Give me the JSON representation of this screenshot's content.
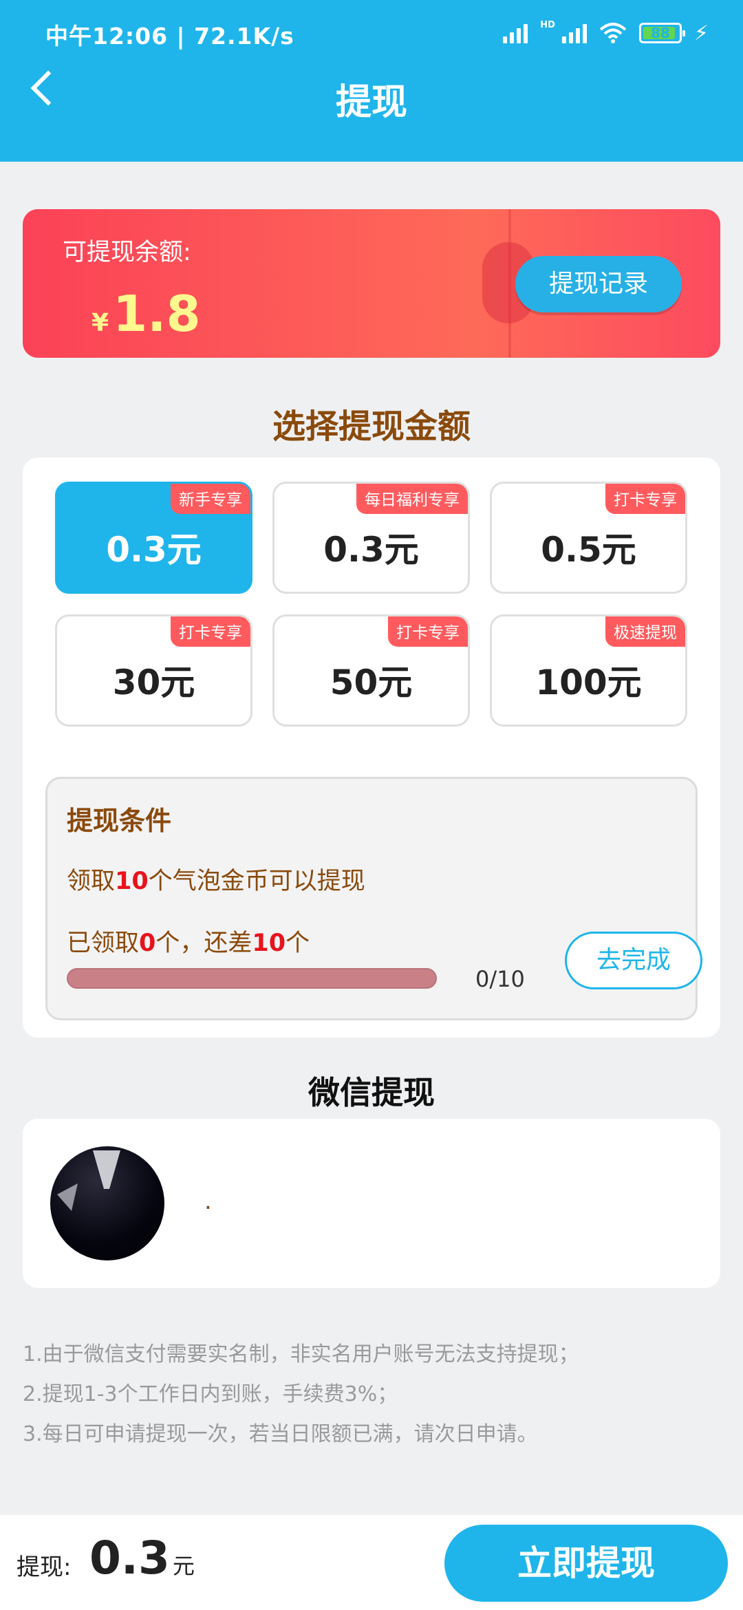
{
  "status_bar": {
    "left": "中午12:06 | 72.1K/s",
    "hd": "HD",
    "battery": "88",
    "charging_icon": "bolt-icon"
  },
  "header": {
    "title": "提现",
    "back_icon": "chevron-left-icon"
  },
  "balance": {
    "label": "可提现余额:",
    "currency": "¥",
    "amount": "1.8",
    "record_button": "提现记录"
  },
  "select_title": "选择提现金额",
  "amounts": [
    {
      "tag": "新手专享",
      "value": "0.3元",
      "selected": true
    },
    {
      "tag": "每日福利专享",
      "value": "0.3元",
      "selected": false
    },
    {
      "tag": "打卡专享",
      "value": "0.5元",
      "selected": false
    },
    {
      "tag": "打卡专享",
      "value": "30元",
      "selected": false
    },
    {
      "tag": "打卡专享",
      "value": "50元",
      "selected": false
    },
    {
      "tag": "极速提现",
      "value": "100元",
      "selected": false
    }
  ],
  "condition": {
    "title": "提现条件",
    "req_prefix": "领取",
    "req_num": "10",
    "req_suffix": "个气泡金币可以提现",
    "got_prefix": "已领取",
    "got_num": "0",
    "got_mid": "个，还差",
    "remain_num": "10",
    "got_suffix": "个",
    "progress_text": "0/10",
    "progress": 0,
    "button": "去完成"
  },
  "wechat": {
    "title": "微信提现",
    "name": "."
  },
  "notes": [
    "1.由于微信支付需要实名制，非实名用户账号无法支持提现；",
    "2.提现1-3个工作日内到账，手续费3%；",
    "3.每日可申请提现一次，若当日限额已满，请次日申请。"
  ],
  "bottom": {
    "label": "提现:",
    "amount": "0.3",
    "unit": "元",
    "button": "立即提现"
  },
  "colors": {
    "primary": "#1fb5ea",
    "accent_red": "#fb4257",
    "tag_red": "#ff5b5e",
    "brown": "#8a4a0c"
  }
}
